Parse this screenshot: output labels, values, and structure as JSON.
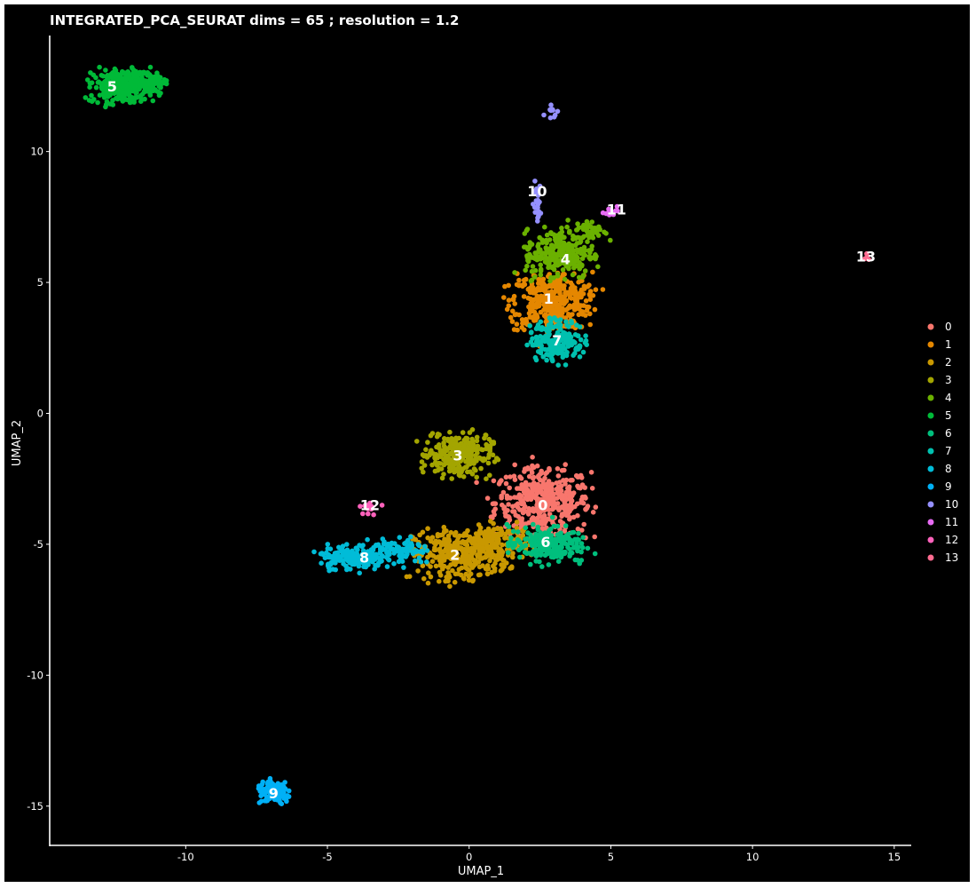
{
  "chart_data": {
    "type": "scatter",
    "title": "INTEGRATED_PCA_SEURAT dims =  65 ; resolution = 1.2",
    "xlabel": "UMAP_1",
    "ylabel": "UMAP_2",
    "xlim": [
      -14.8,
      15.6
    ],
    "ylim": [
      -16.5,
      14.6
    ],
    "xticks": [
      -10,
      -5,
      0,
      5,
      10,
      15
    ],
    "yticks": [
      -15,
      -10,
      -5,
      0,
      5,
      10
    ],
    "grid": false,
    "legend_position": "right",
    "series": [
      {
        "name": "0",
        "color": "#F8766D",
        "label": "0",
        "label_pos": [
          2.6,
          -3.5
        ],
        "blobs": [
          {
            "cx": 2.6,
            "cy": -3.4,
            "rx": 1.4,
            "ry": 1.1,
            "n": 420
          }
        ]
      },
      {
        "name": "1",
        "color": "#E58700",
        "label": "1",
        "label_pos": [
          2.8,
          4.4
        ],
        "blobs": [
          {
            "cx": 2.9,
            "cy": 4.3,
            "rx": 1.2,
            "ry": 0.9,
            "n": 380
          }
        ]
      },
      {
        "name": "2",
        "color": "#C99800",
        "label": "2",
        "label_pos": [
          -0.5,
          -5.4
        ],
        "blobs": [
          {
            "cx": -0.3,
            "cy": -5.4,
            "rx": 1.4,
            "ry": 0.8,
            "n": 320
          },
          {
            "cx": 1.0,
            "cy": -4.9,
            "rx": 1.0,
            "ry": 0.6,
            "n": 140
          }
        ]
      },
      {
        "name": "3",
        "color": "#A3A500",
        "label": "3",
        "label_pos": [
          -0.4,
          -1.6
        ],
        "blobs": [
          {
            "cx": -0.4,
            "cy": -1.6,
            "rx": 1.0,
            "ry": 0.7,
            "n": 260
          }
        ]
      },
      {
        "name": "4",
        "color": "#6BB100",
        "label": "4",
        "label_pos": [
          3.4,
          5.9
        ],
        "blobs": [
          {
            "cx": 3.2,
            "cy": 6.1,
            "rx": 1.0,
            "ry": 0.8,
            "n": 260
          },
          {
            "cx": 4.3,
            "cy": 7.0,
            "rx": 0.5,
            "ry": 0.3,
            "n": 40
          }
        ]
      },
      {
        "name": "5",
        "color": "#00BA38",
        "label": "5",
        "label_pos": [
          -12.6,
          12.5
        ],
        "blobs": [
          {
            "cx": -12.2,
            "cy": 12.5,
            "rx": 1.0,
            "ry": 0.55,
            "n": 260
          },
          {
            "cx": -11.3,
            "cy": 12.7,
            "rx": 0.5,
            "ry": 0.3,
            "n": 60
          }
        ]
      },
      {
        "name": "6",
        "color": "#00BF7D",
        "label": "6",
        "label_pos": [
          2.7,
          -4.9
        ],
        "blobs": [
          {
            "cx": 2.7,
            "cy": -5.0,
            "rx": 1.1,
            "ry": 0.6,
            "n": 220
          }
        ]
      },
      {
        "name": "7",
        "color": "#00C0AF",
        "label": "7",
        "label_pos": [
          3.1,
          2.8
        ],
        "blobs": [
          {
            "cx": 3.1,
            "cy": 2.8,
            "rx": 0.8,
            "ry": 0.65,
            "n": 200
          }
        ]
      },
      {
        "name": "8",
        "color": "#00BCD8",
        "label": "8",
        "label_pos": [
          -3.7,
          -5.5
        ],
        "blobs": [
          {
            "cx": -4.2,
            "cy": -5.5,
            "rx": 0.9,
            "ry": 0.4,
            "n": 150
          },
          {
            "cx": -2.5,
            "cy": -5.3,
            "rx": 0.9,
            "ry": 0.45,
            "n": 110
          }
        ]
      },
      {
        "name": "9",
        "color": "#00B0F6",
        "label": "9",
        "label_pos": [
          -6.9,
          -14.5
        ],
        "blobs": [
          {
            "cx": -6.9,
            "cy": -14.5,
            "rx": 0.5,
            "ry": 0.35,
            "n": 140
          }
        ]
      },
      {
        "name": "10",
        "color": "#9590FF",
        "label": "10",
        "label_pos": [
          2.4,
          8.5
        ],
        "blobs": [
          {
            "cx": 2.4,
            "cy": 8.1,
            "rx": 0.12,
            "ry": 0.6,
            "n": 25
          },
          {
            "cx": 2.9,
            "cy": 11.6,
            "rx": 0.2,
            "ry": 0.3,
            "n": 10
          }
        ]
      },
      {
        "name": "11",
        "color": "#E76BF3",
        "label": "11",
        "label_pos": [
          5.2,
          7.8
        ],
        "blobs": [
          {
            "cx": 5.0,
            "cy": 7.75,
            "rx": 0.35,
            "ry": 0.2,
            "n": 14
          }
        ]
      },
      {
        "name": "12",
        "color": "#FF62BC",
        "label": "12",
        "label_pos": [
          -3.5,
          -3.5
        ],
        "blobs": [
          {
            "cx": -3.5,
            "cy": -3.6,
            "rx": 0.3,
            "ry": 0.25,
            "n": 14
          }
        ]
      },
      {
        "name": "13",
        "color": "#FF6C91",
        "label": "13",
        "label_pos": [
          14.0,
          6.0
        ],
        "blobs": [
          {
            "cx": 14.0,
            "cy": 6.0,
            "rx": 0.1,
            "ry": 0.1,
            "n": 4
          }
        ]
      }
    ]
  }
}
